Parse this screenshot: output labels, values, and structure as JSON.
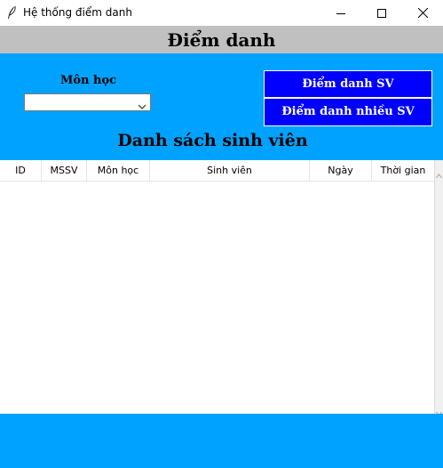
{
  "window": {
    "title": "Hệ thống điểm danh"
  },
  "header": {
    "title": "Điểm danh"
  },
  "controls": {
    "subject_label": "Môn học",
    "subject_value": "",
    "attend_single_label": "Điểm danh SV",
    "attend_multi_label": "Điểm danh nhiều SV"
  },
  "list": {
    "title": "Danh sách sinh viên",
    "columns": [
      "ID",
      "MSSV",
      "Môn học",
      "Sinh viên",
      "Ngày",
      "Thời gian"
    ],
    "rows": []
  },
  "colors": {
    "accent_blue": "#00a2ff",
    "button_blue": "#0000ff",
    "header_gray": "#c0c0c0"
  },
  "icons": {
    "app": "feather-icon",
    "minimize": "minimize-icon",
    "maximize": "maximize-icon",
    "close": "close-icon",
    "dropdown": "chevron-down-icon"
  }
}
